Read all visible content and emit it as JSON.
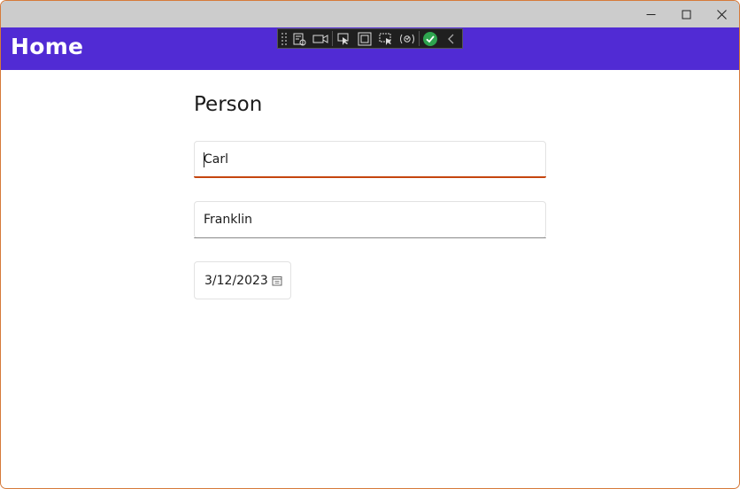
{
  "window": {
    "minimize_icon": "minimize-icon",
    "maximize_icon": "maximize-icon",
    "close_icon": "close-icon"
  },
  "nav": {
    "title": "Home"
  },
  "devtools": {
    "icons": [
      "live-visual-tree-icon",
      "video-capture-icon",
      "select-element-icon",
      "display-layout-adorners-icon",
      "track-focus-icon",
      "hot-reload-icon",
      "checkmark-icon",
      "collapse-chevron-icon"
    ],
    "accent": "#2ea44f"
  },
  "page": {
    "heading": "Person",
    "first_name": {
      "value": "Carl"
    },
    "last_name": {
      "value": "Franklin"
    },
    "date_picker": {
      "value": "3/12/2023",
      "icon": "calendar-icon"
    }
  },
  "colors": {
    "brand": "#512bd4",
    "focus_underline": "#c5460f",
    "titlebar": "#cccccc"
  }
}
